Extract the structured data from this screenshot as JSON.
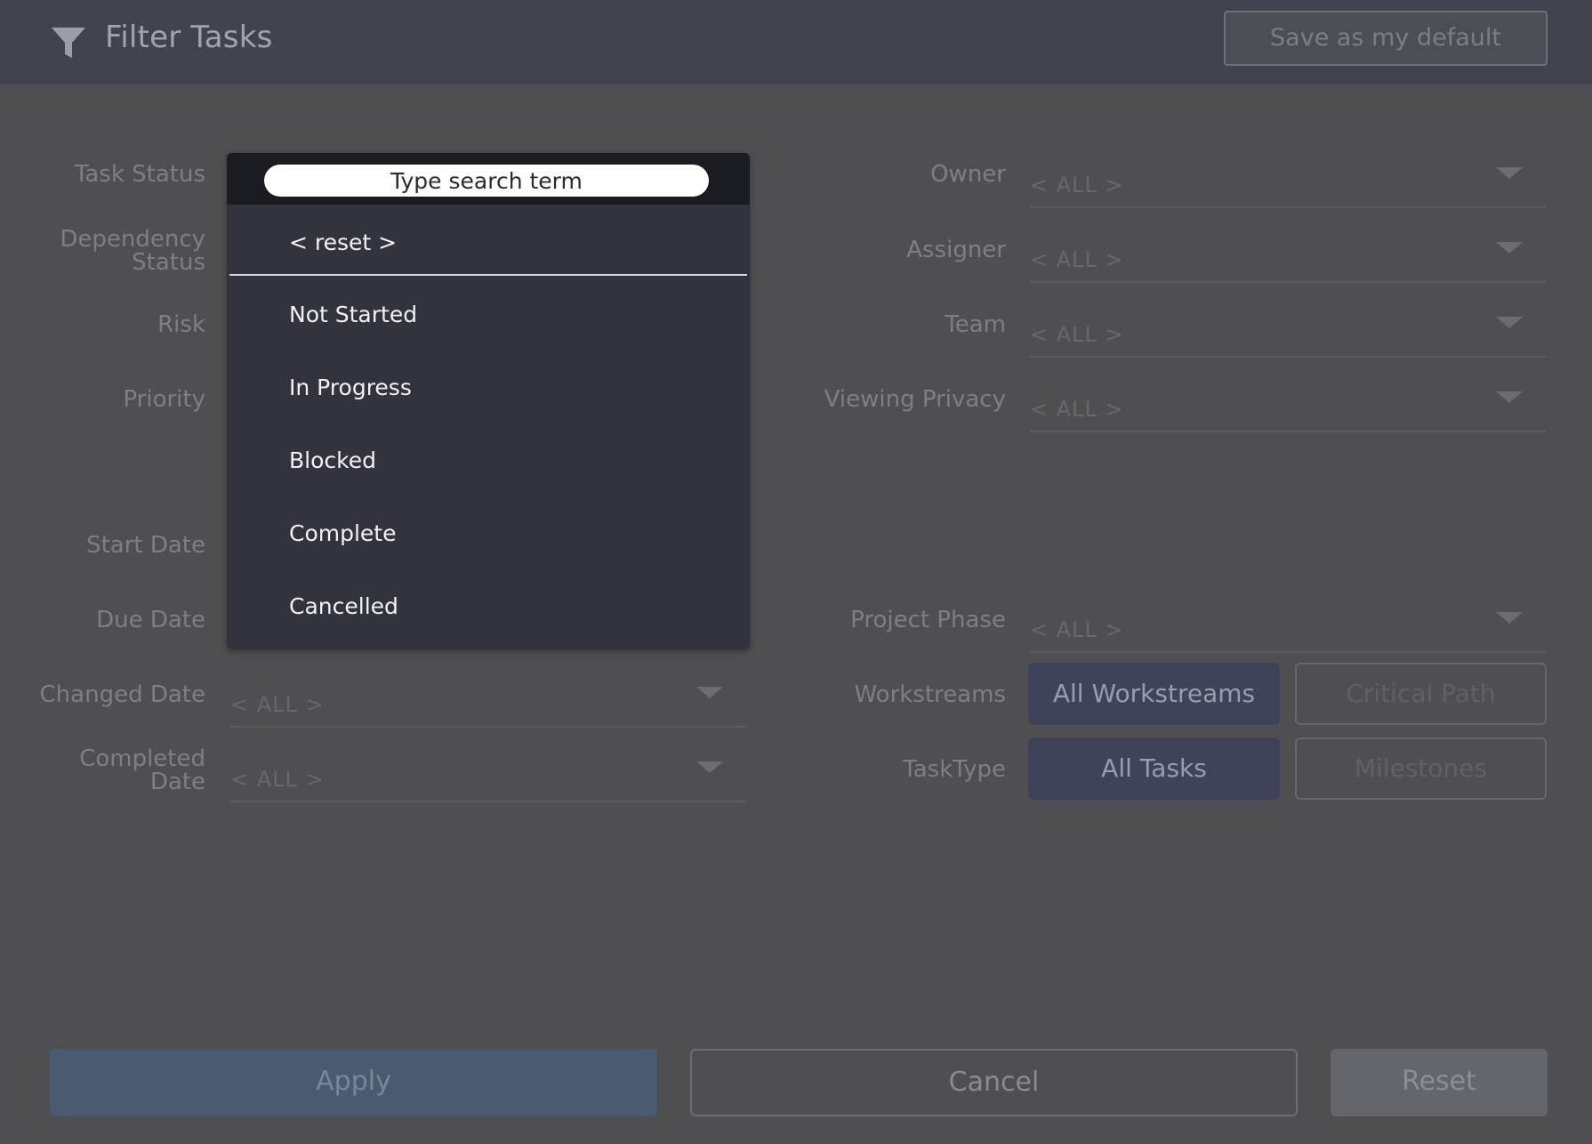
{
  "header": {
    "title": "Filter Tasks",
    "save_default_label": "Save as my default"
  },
  "left_labels": {
    "task_status": "Task Status",
    "dependency_status": "Dependency\nStatus",
    "risk": "Risk",
    "priority": "Priority",
    "start_date": "Start Date",
    "due_date": "Due Date",
    "changed_date": "Changed Date",
    "completed_date": "Completed\nDate"
  },
  "left_fields": {
    "changed_date_value": "< ALL >",
    "completed_date_value": "< ALL >"
  },
  "right_labels": {
    "owner": "Owner",
    "assigner": "Assigner",
    "team": "Team",
    "viewing_privacy": "Viewing Privacy",
    "project_phase": "Project Phase",
    "workstreams": "Workstreams",
    "tasktype": "TaskType"
  },
  "right_fields": {
    "owner_value": "< ALL >",
    "assigner_value": "< ALL >",
    "team_value": "< ALL >",
    "viewing_privacy_value": "< ALL >",
    "project_phase_value": "< ALL >"
  },
  "toggles": {
    "workstreams": [
      "All Workstreams",
      "Critical Path"
    ],
    "tasktype": [
      "All Tasks",
      "Milestones"
    ]
  },
  "dropdown": {
    "search_placeholder": "Type search term",
    "reset_label": "< reset >",
    "options": [
      "Not Started",
      "In Progress",
      "Blocked",
      "Complete",
      "Cancelled"
    ]
  },
  "footer": {
    "apply_label": "Apply",
    "cancel_label": "Cancel",
    "reset_label": "Reset"
  },
  "colors": {
    "background": "#4f4f51",
    "header_bg": "#42434f",
    "dropdown_bg": "#32333d",
    "apply_bg": "#4a5a70",
    "toggle_active_bg": "#40425a"
  },
  "icons": {
    "header_icon": "filter-icon",
    "field_dropdown": "chevron-down-icon"
  }
}
